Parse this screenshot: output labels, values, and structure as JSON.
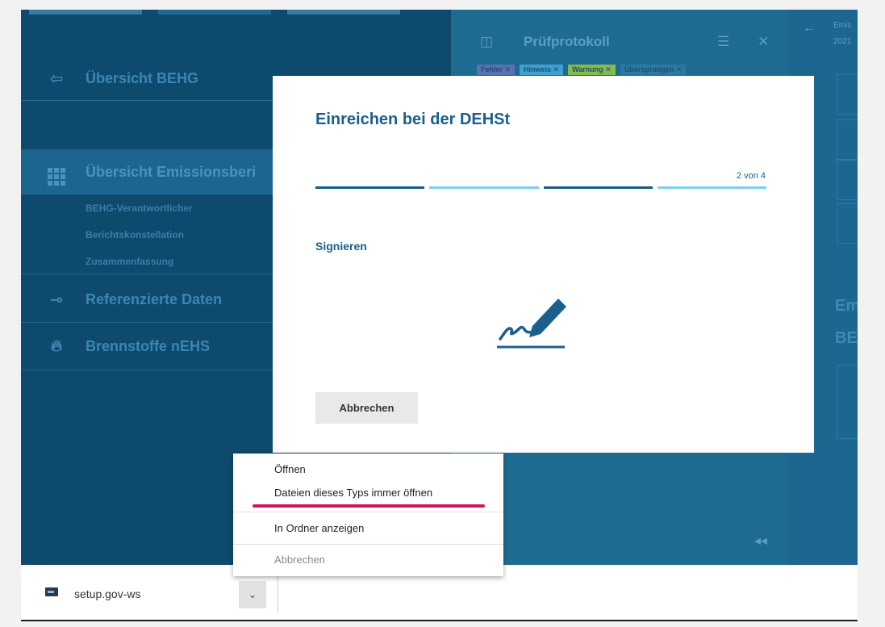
{
  "colors": {
    "accent": "#1a5f8e",
    "step_done": "#145b86",
    "step_pending": "#7fcff2",
    "highlight_mark": "#d6135e"
  },
  "sidebar": {
    "overview_behg": {
      "label": "Übersicht BEHG",
      "icon": "sign-in-icon"
    },
    "overview_reports": {
      "label": "Übersicht Emissionsberi",
      "icon": "grid-icon"
    },
    "subitems": [
      "BEHG-Verantwortlicher",
      "Berichtskonstellation",
      "Zusammenfassung"
    ],
    "referenced": {
      "label": "Referenzierte Daten",
      "icon": "key-icon"
    },
    "fuels": {
      "label": "Brennstoffe nEHS",
      "icon": "flame-icon"
    }
  },
  "panel": {
    "title": "Prüfprotokoll",
    "icons": [
      "book-icon",
      "filter-icon",
      "close-icon"
    ],
    "chips": [
      {
        "label": "Fehler ✕",
        "color": "#5a6fb4"
      },
      {
        "label": "Hinweis ✕",
        "color": "#3f9fd3"
      },
      {
        "label": "Warnung ✕",
        "color": "#86b94f"
      },
      {
        "label": "Übersprungen ✕",
        "color": "#2b78a3"
      }
    ],
    "collapse": "◂◂"
  },
  "far_panel": {
    "back": "←",
    "text_line1": "Emis",
    "text_line2": "2021",
    "heading_line1": "Em",
    "heading_line2": "BE"
  },
  "modal": {
    "title": "Einreichen bei der DEHSt",
    "step_label": "2 von 4",
    "steps": [
      "done",
      "pending",
      "done",
      "pending"
    ],
    "sublabel": "Signieren",
    "cancel": "Abbrechen",
    "icon": "signature-pen-icon"
  },
  "context_menu": {
    "items": [
      "Öffnen",
      "Dateien dieses Typs immer öffnen",
      "In Ordner anzeigen",
      "Abbrechen"
    ]
  },
  "download_bar": {
    "filename": "setup.gov-ws",
    "arrow": "⌄"
  }
}
